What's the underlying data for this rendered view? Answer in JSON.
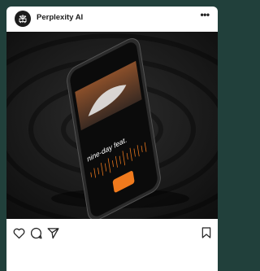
{
  "post": {
    "account_name": "Perplexity AI",
    "more_icon": "more-horizontal-icon",
    "avatar_icon": "perplexity-logo-icon"
  },
  "media": {
    "phone_screen_text": "nine-day feat."
  },
  "actions": {
    "like_icon": "heart-icon",
    "comment_icon": "comment-icon",
    "share_icon": "send-icon",
    "save_icon": "bookmark-icon"
  },
  "colors": {
    "background": "#21403b",
    "card": "#ffffff",
    "accent_orange": "#f07a1d"
  }
}
